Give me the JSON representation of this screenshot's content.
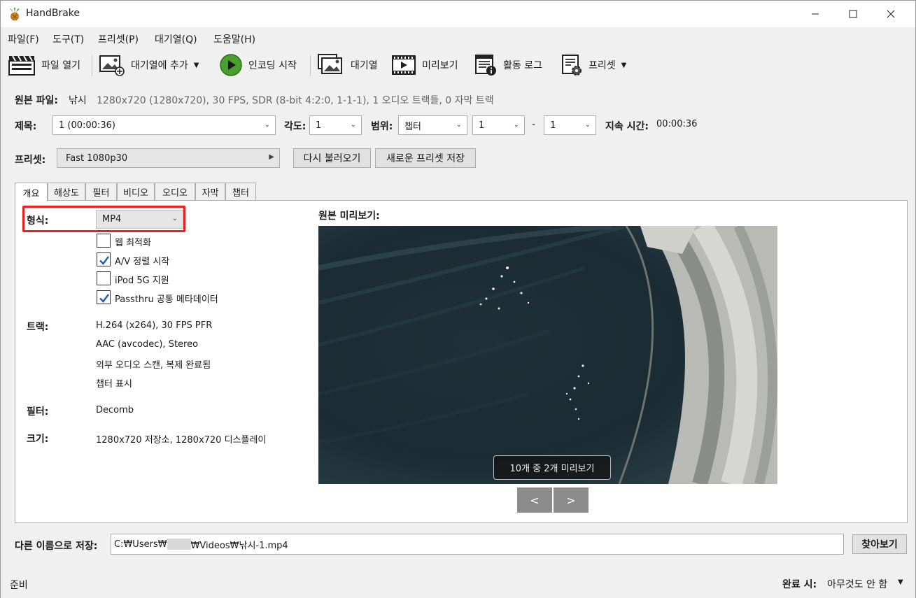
{
  "window": {
    "title": "HandBrake",
    "colors": {
      "highlight": "#e8201f",
      "check": "#1a5fb4"
    }
  },
  "menu": [
    "파일(F)",
    "도구(T)",
    "프리셋(P)",
    "대기열(Q)",
    "도움말(H)"
  ],
  "toolbar": {
    "open": "파일 열기",
    "add_queue": "대기열에 추가",
    "start": "인코딩 시작",
    "queue": "대기열",
    "preview": "미리보기",
    "log": "활동 로그",
    "presets": "프리셋"
  },
  "source": {
    "label": "원본 파일:",
    "name": "낚시",
    "info": "1280x720 (1280x720), 30 FPS, SDR (8-bit 4:2:0, 1-1-1), 1 오디오 트랙들, 0 자막 트랙"
  },
  "title_row": {
    "title_label": "제목:",
    "title_value": "1  (00:00:36)",
    "angle_label": "각도:",
    "angle_value": "1",
    "range_label": "범위:",
    "range_type": "챕터",
    "range_start": "1",
    "dash": "-",
    "range_end": "1",
    "duration_label": "지속 시간:",
    "duration_value": "00:00:36"
  },
  "preset_row": {
    "label": "프리셋:",
    "value": "Fast 1080p30",
    "reload": "다시 불러오기",
    "save_new": "새로운 프리셋 저장"
  },
  "tabs": [
    "개요",
    "해상도",
    "필터",
    "비디오",
    "오디오",
    "자막",
    "챕터"
  ],
  "summary": {
    "format_label": "형식:",
    "format_value": "MP4",
    "options": [
      {
        "label": "웹 최적화",
        "checked": false
      },
      {
        "label": "A/V 정렬 시작",
        "checked": true
      },
      {
        "label": "iPod 5G 지원",
        "checked": false
      },
      {
        "label": "Passthru 공통 메타데이터",
        "checked": true
      }
    ],
    "tracks_label": "트랙:",
    "tracks": [
      "H.264 (x264), 30 FPS PFR",
      "AAC (avcodec), Stereo",
      "외부 오디오 스캔, 복제 완료됨",
      "챕터 표시"
    ],
    "filters_label": "필터:",
    "filters_value": "Decomb",
    "size_label": "크기:",
    "size_value": "1280x720 저장소, 1280x720 디스플레이",
    "preview_label": "원본 미리보기:",
    "preview_caption": "10개 중 2개 미리보기",
    "prev": "<",
    "next": ">"
  },
  "save_as": {
    "label": "다른 이름으로 저장:",
    "path_start": "C:₩Users₩",
    "path_end": "₩Videos₩낚시-1.mp4",
    "browse": "찾아보기"
  },
  "status": {
    "left": "준비",
    "when_done_label": "완료 시:",
    "when_done_value": "아무것도 안 함"
  }
}
